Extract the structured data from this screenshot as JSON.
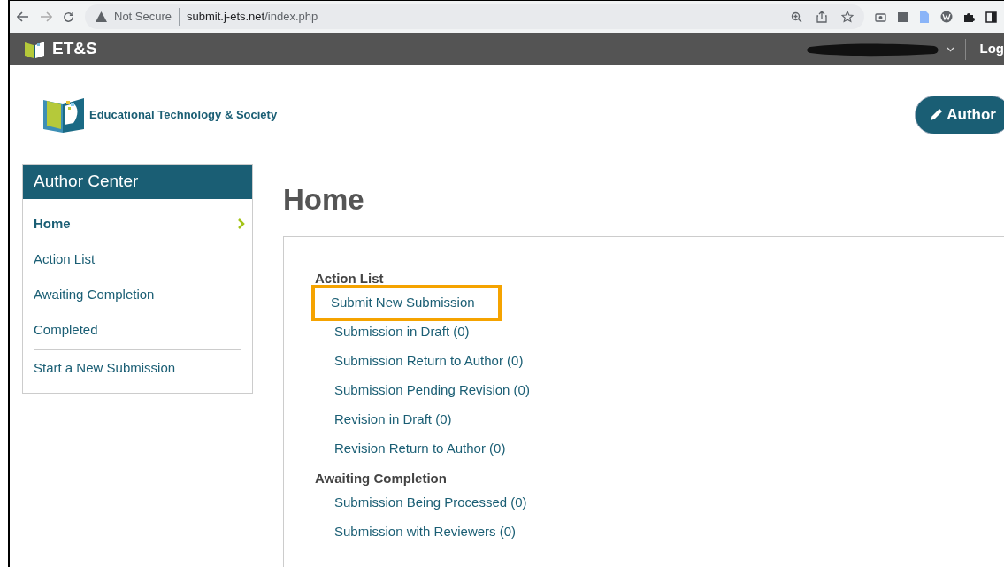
{
  "browser": {
    "security": "Not Secure",
    "url_host": "submit.j-ets.net",
    "url_path": "/index.php"
  },
  "navbar": {
    "brand": "ET&S",
    "login": "Log"
  },
  "header": {
    "journal": "Educational Technology & Society",
    "role_button": "Author"
  },
  "sidebar": {
    "title": "Author Center",
    "items": [
      {
        "label": "Home",
        "selected": true
      },
      {
        "label": "Action List",
        "selected": false
      },
      {
        "label": "Awaiting Completion",
        "selected": false
      },
      {
        "label": "Completed",
        "selected": false
      },
      {
        "label": "Start a New Submission",
        "selected": false
      }
    ]
  },
  "main": {
    "title": "Home",
    "sections": [
      {
        "heading": "Action List",
        "links": [
          {
            "label": "Submit New Submission",
            "highlighted": true
          },
          {
            "label": "Submission in Draft (0)",
            "highlighted": false
          },
          {
            "label": "Submission Return to Author (0)",
            "highlighted": false
          },
          {
            "label": "Submission Pending Revision (0)",
            "highlighted": false
          },
          {
            "label": "Revision in Draft (0)",
            "highlighted": false
          },
          {
            "label": "Revision Return to Author (0)",
            "highlighted": false
          }
        ]
      },
      {
        "heading": "Awaiting Completion",
        "links": [
          {
            "label": "Submission Being Processed (0)",
            "highlighted": false
          },
          {
            "label": "Submission with Reviewers (0)",
            "highlighted": false
          }
        ]
      }
    ]
  }
}
